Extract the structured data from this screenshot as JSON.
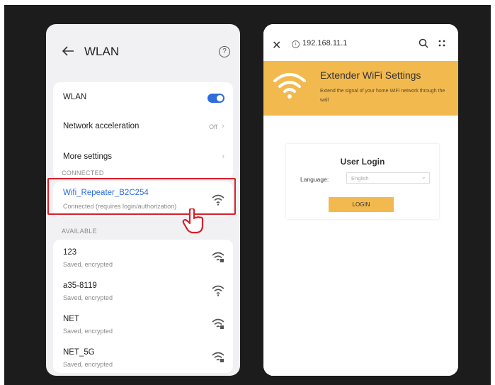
{
  "wlan": {
    "title": "WLAN",
    "help_glyph": "?",
    "settings": [
      {
        "label": "WLAN",
        "kind": "toggle",
        "value": "on"
      },
      {
        "label": "Network acceleration",
        "kind": "value",
        "value": "Off"
      },
      {
        "label": "More settings",
        "kind": "chevron",
        "value": ""
      }
    ],
    "connected_header": "CONNECTED",
    "connected": {
      "name": "Wifi_Repeater_B2C254",
      "status": "Connected (requires login/authorization)"
    },
    "available_header": "AVAILABLE",
    "available": [
      {
        "name": "123",
        "status": "Saved, encrypted"
      },
      {
        "name": "a35-8119",
        "status": "Saved, encrypted"
      },
      {
        "name": "NET",
        "status": "Saved, encrypted"
      },
      {
        "name": "NET_5G",
        "status": "Saved, encrypted"
      }
    ]
  },
  "browser": {
    "url": "192.168.11.1",
    "banner_title": "Extender WiFi Settings",
    "banner_desc": "Extend the signal of your home WiFi network through the wall",
    "login_title": "User Login",
    "language_label": "Language:",
    "language_value": "English",
    "login_button": "LOGIN"
  },
  "colors": {
    "accent_blue": "#2f6cdc",
    "highlight_red": "#d8202b",
    "banner_orange": "#f2b94f",
    "frame_dark": "#1c1c1c"
  }
}
